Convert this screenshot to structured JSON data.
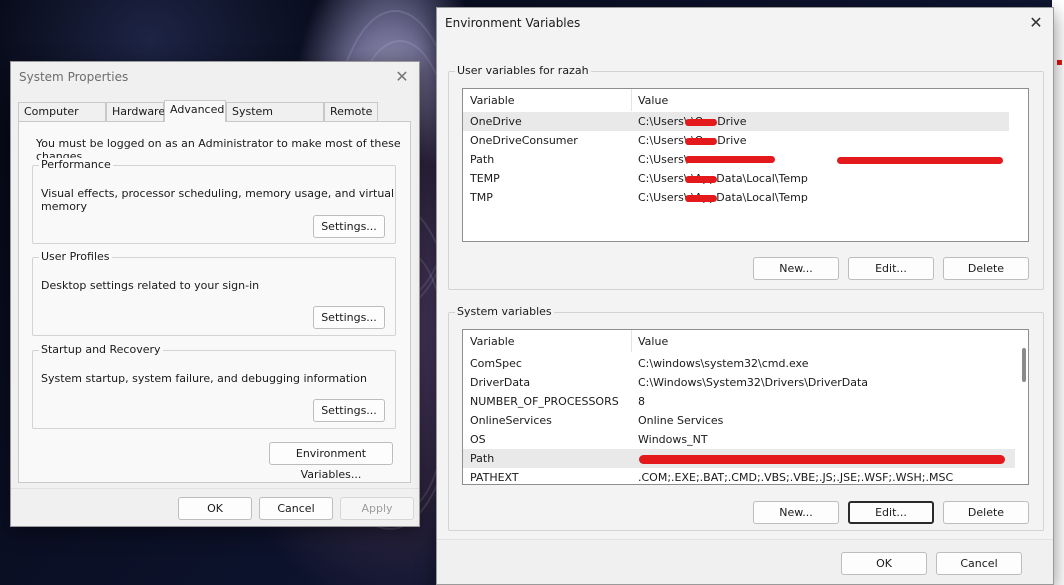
{
  "system_properties": {
    "title": "System Properties",
    "tabs": [
      "Computer Name",
      "Hardware",
      "Advanced",
      "System Protection",
      "Remote"
    ],
    "active_tab": "Advanced",
    "admin_note": "You must be logged on as an Administrator to make most of these changes.",
    "performance": {
      "label": "Performance",
      "description": "Visual effects, processor scheduling, memory usage, and virtual memory",
      "button": "Settings..."
    },
    "user_profiles": {
      "label": "User Profiles",
      "description": "Desktop settings related to your sign-in",
      "button": "Settings..."
    },
    "startup_recovery": {
      "label": "Startup and Recovery",
      "description": "System startup, system failure, and debugging information",
      "button": "Settings..."
    },
    "env_button": "Environment Variables...",
    "ok": "OK",
    "cancel": "Cancel",
    "apply": "Apply"
  },
  "environment_variables": {
    "title": "Environment Variables",
    "user_group_label": "User variables for razah",
    "system_group_label": "System variables",
    "columns": {
      "variable": "Variable",
      "value": "Value"
    },
    "user_vars": [
      {
        "name": "OneDrive",
        "value": "C:\\Users\\        \\OneDrive",
        "selected": true
      },
      {
        "name": "OneDriveConsumer",
        "value": "C:\\Users\\        \\OneDrive",
        "selected": false
      },
      {
        "name": "Path",
        "value": "C:\\Users\\",
        "selected": false
      },
      {
        "name": "TEMP",
        "value": "C:\\Users\\        \\AppData\\Local\\Temp",
        "selected": false
      },
      {
        "name": "TMP",
        "value": "C:\\Users\\        \\AppData\\Local\\Temp",
        "selected": false
      }
    ],
    "system_vars": [
      {
        "name": "ComSpec",
        "value": "C:\\windows\\system32\\cmd.exe",
        "selected": false
      },
      {
        "name": "DriverData",
        "value": "C:\\Windows\\System32\\Drivers\\DriverData",
        "selected": false
      },
      {
        "name": "NUMBER_OF_PROCESSORS",
        "value": "8",
        "selected": false
      },
      {
        "name": "OnlineServices",
        "value": "Online Services",
        "selected": false
      },
      {
        "name": "OS",
        "value": "Windows_NT",
        "selected": false
      },
      {
        "name": "Path",
        "value": "",
        "selected": true
      },
      {
        "name": "PATHEXT",
        "value": ".COM;.EXE;.BAT;.CMD;.VBS;.VBE;.JS;.JSE;.WSF;.WSH;.MSC",
        "selected": false
      }
    ],
    "user_buttons": {
      "new": "New...",
      "edit": "Edit...",
      "delete": "Delete"
    },
    "system_buttons": {
      "new": "New...",
      "edit": "Edit...",
      "delete": "Delete"
    },
    "ok": "OK",
    "cancel": "Cancel"
  },
  "icons": {
    "close": "close-icon"
  },
  "colors": {
    "redaction": "#e3191c",
    "selected_row": "#e9e9e9"
  }
}
